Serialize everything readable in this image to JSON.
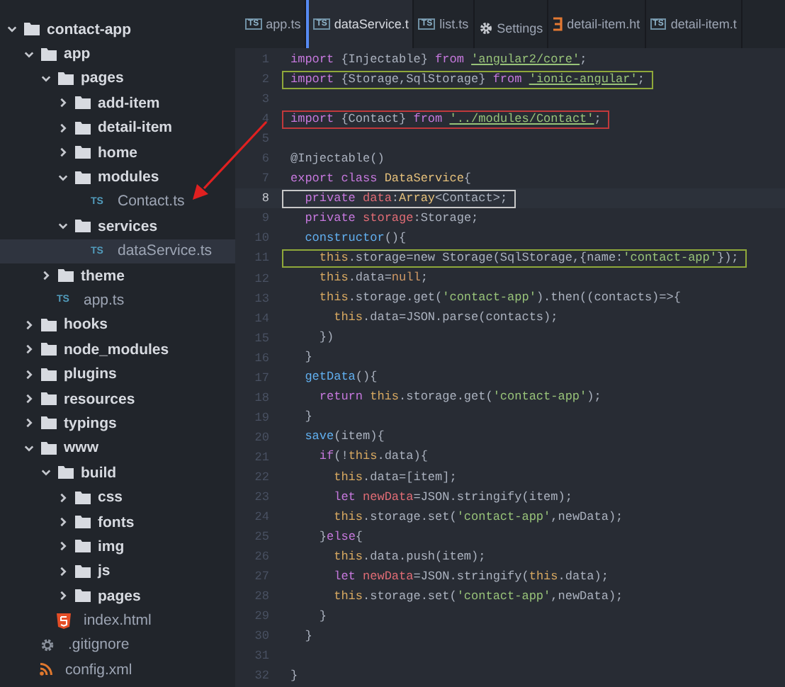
{
  "sidebar": {
    "tree": [
      {
        "name": "contact-app",
        "kind": "folder",
        "expanded": true,
        "selected": false,
        "children": [
          {
            "name": "app",
            "kind": "folder",
            "expanded": true,
            "selected": false,
            "children": [
              {
                "name": "pages",
                "kind": "folder",
                "expanded": true,
                "selected": false,
                "children": [
                  {
                    "name": "add-item",
                    "kind": "folder",
                    "expanded": false,
                    "selected": false
                  },
                  {
                    "name": "detail-item",
                    "kind": "folder",
                    "expanded": false,
                    "selected": false
                  },
                  {
                    "name": "home",
                    "kind": "folder",
                    "expanded": false,
                    "selected": false
                  },
                  {
                    "name": "modules",
                    "kind": "folder",
                    "expanded": true,
                    "selected": false,
                    "children": [
                      {
                        "name": "Contact.ts",
                        "kind": "ts",
                        "badge": "TS",
                        "selected": false
                      }
                    ]
                  },
                  {
                    "name": "services",
                    "kind": "folder",
                    "expanded": true,
                    "selected": false,
                    "children": [
                      {
                        "name": "dataService.ts",
                        "kind": "ts",
                        "badge": "TS",
                        "selected": true
                      }
                    ]
                  }
                ]
              },
              {
                "name": "theme",
                "kind": "folder",
                "expanded": false,
                "selected": false
              },
              {
                "name": "app.ts",
                "kind": "ts",
                "badge": "TS",
                "selected": false
              }
            ]
          },
          {
            "name": "hooks",
            "kind": "folder",
            "expanded": false,
            "selected": false
          },
          {
            "name": "node_modules",
            "kind": "folder",
            "expanded": false,
            "selected": false
          },
          {
            "name": "plugins",
            "kind": "folder",
            "expanded": false,
            "selected": false
          },
          {
            "name": "resources",
            "kind": "folder",
            "expanded": false,
            "selected": false
          },
          {
            "name": "typings",
            "kind": "folder",
            "expanded": false,
            "selected": false
          },
          {
            "name": "www",
            "kind": "folder",
            "expanded": true,
            "selected": false,
            "children": [
              {
                "name": "build",
                "kind": "folder",
                "expanded": true,
                "selected": false,
                "children": [
                  {
                    "name": "css",
                    "kind": "folder",
                    "expanded": false,
                    "selected": false
                  },
                  {
                    "name": "fonts",
                    "kind": "folder",
                    "expanded": false,
                    "selected": false
                  },
                  {
                    "name": "img",
                    "kind": "folder",
                    "expanded": false,
                    "selected": false
                  },
                  {
                    "name": "js",
                    "kind": "folder",
                    "expanded": false,
                    "selected": false
                  },
                  {
                    "name": "pages",
                    "kind": "folder",
                    "expanded": false,
                    "selected": false
                  }
                ]
              },
              {
                "name": "index.html",
                "kind": "html",
                "selected": false
              }
            ]
          },
          {
            "name": ".gitignore",
            "kind": "config",
            "selected": false
          },
          {
            "name": "config.xml",
            "kind": "xml",
            "selected": false
          }
        ]
      }
    ]
  },
  "tabs": [
    {
      "label": "app.ts",
      "kind": "ts",
      "badge": "TS",
      "selected": false
    },
    {
      "label": "dataService.t",
      "kind": "ts",
      "badge": "TS",
      "selected": true
    },
    {
      "label": "list.ts",
      "kind": "ts",
      "badge": "TS",
      "selected": false
    },
    {
      "label": "Settings",
      "kind": "settings",
      "selected": false
    },
    {
      "label": "detail-item.ht",
      "kind": "html",
      "selected": false
    },
    {
      "label": "detail-item.t",
      "kind": "ts",
      "badge": "TS",
      "selected": false
    }
  ],
  "editor": {
    "lines": [
      {
        "n": "1",
        "tokens": [
          {
            "kind": "kw",
            "text": "import"
          },
          {
            "kind": "plain",
            "text": " {Injectable} "
          },
          {
            "kind": "kw",
            "text": "from "
          },
          {
            "kind": "link",
            "text": "'angular2/core'"
          },
          {
            "kind": "plain",
            "text": ";"
          }
        ]
      },
      {
        "n": "2",
        "color": "#8fa83a",
        "tokens": [
          {
            "kind": "kw",
            "text": "import"
          },
          {
            "kind": "plain",
            "text": " {Storage,SqlStorage} "
          },
          {
            "kind": "kw",
            "text": "from "
          },
          {
            "kind": "link",
            "text": "'ionic-angular'"
          },
          {
            "kind": "plain",
            "text": ";"
          }
        ]
      },
      {
        "n": "3"
      },
      {
        "n": "4",
        "color": "#c0393b",
        "tokens": [
          {
            "kind": "kw",
            "text": "import"
          },
          {
            "kind": "plain",
            "text": " {Contact} "
          },
          {
            "kind": "kw",
            "text": "from "
          },
          {
            "kind": "link",
            "text": "'../modules/Contact'"
          },
          {
            "kind": "plain",
            "text": ";"
          }
        ]
      },
      {
        "n": "5"
      },
      {
        "n": "6",
        "tokens": [
          {
            "kind": "plain",
            "text": "@Injectable()"
          }
        ]
      },
      {
        "n": "7",
        "tokens": [
          {
            "kind": "kw",
            "text": "export class "
          },
          {
            "kind": "type",
            "text": "DataService"
          },
          {
            "kind": "plain",
            "text": "{"
          }
        ]
      },
      {
        "n": "8",
        "current": true,
        "color": "#c8c8c8",
        "tokens": [
          {
            "kind": "kw",
            "text": "  private "
          },
          {
            "kind": "var",
            "text": "data"
          },
          {
            "kind": "plain",
            "text": ":"
          },
          {
            "kind": "type",
            "text": "Array"
          },
          {
            "kind": "plain",
            "text": "<Contact>;"
          }
        ]
      },
      {
        "n": "9",
        "tokens": [
          {
            "kind": "kw",
            "text": "  private "
          },
          {
            "kind": "var",
            "text": "storage"
          },
          {
            "kind": "plain",
            "text": ":Storage;"
          }
        ]
      },
      {
        "n": "10",
        "tokens": [
          {
            "kind": "fn",
            "text": "  constructor"
          },
          {
            "kind": "plain",
            "text": "(){"
          }
        ]
      },
      {
        "n": "11",
        "color": "#8fa83a",
        "tokens": [
          {
            "kind": "this",
            "text": "    this"
          },
          {
            "kind": "plain",
            "text": ".storage=new Storage(SqlStorage,{name:"
          },
          {
            "kind": "str",
            "text": "'contact-app'"
          },
          {
            "kind": "plain",
            "text": "});"
          }
        ]
      },
      {
        "n": "12",
        "tokens": [
          {
            "kind": "this",
            "text": "    this"
          },
          {
            "kind": "plain",
            "text": ".data="
          },
          {
            "kind": "const",
            "text": "null"
          },
          {
            "kind": "plain",
            "text": ";"
          }
        ]
      },
      {
        "n": "13",
        "tokens": [
          {
            "kind": "this",
            "text": "    this"
          },
          {
            "kind": "plain",
            "text": ".storage.get("
          },
          {
            "kind": "str",
            "text": "'contact-app'"
          },
          {
            "kind": "plain",
            "text": ").then((contacts)=>{"
          }
        ]
      },
      {
        "n": "14",
        "tokens": [
          {
            "kind": "this",
            "text": "      this"
          },
          {
            "kind": "plain",
            "text": ".data=JSON.parse(contacts);"
          }
        ]
      },
      {
        "n": "15",
        "tokens": [
          {
            "kind": "plain",
            "text": "    })"
          }
        ]
      },
      {
        "n": "16",
        "tokens": [
          {
            "kind": "plain",
            "text": "  }"
          }
        ]
      },
      {
        "n": "17",
        "tokens": [
          {
            "kind": "fn",
            "text": "  getData"
          },
          {
            "kind": "plain",
            "text": "(){"
          }
        ]
      },
      {
        "n": "18",
        "tokens": [
          {
            "kind": "kw",
            "text": "    return "
          },
          {
            "kind": "this",
            "text": "this"
          },
          {
            "kind": "plain",
            "text": ".storage.get("
          },
          {
            "kind": "str",
            "text": "'contact-app'"
          },
          {
            "kind": "plain",
            "text": ");"
          }
        ]
      },
      {
        "n": "19",
        "tokens": [
          {
            "kind": "plain",
            "text": "  }"
          }
        ]
      },
      {
        "n": "20",
        "tokens": [
          {
            "kind": "fn",
            "text": "  save"
          },
          {
            "kind": "plain",
            "text": "(item){"
          }
        ]
      },
      {
        "n": "21",
        "tokens": [
          {
            "kind": "kw",
            "text": "    if"
          },
          {
            "kind": "plain",
            "text": "(!"
          },
          {
            "kind": "this",
            "text": "this"
          },
          {
            "kind": "plain",
            "text": ".data){"
          }
        ]
      },
      {
        "n": "22",
        "tokens": [
          {
            "kind": "this",
            "text": "      this"
          },
          {
            "kind": "plain",
            "text": ".data=[item];"
          }
        ]
      },
      {
        "n": "23",
        "tokens": [
          {
            "kind": "kw",
            "text": "      let "
          },
          {
            "kind": "var",
            "text": "newData"
          },
          {
            "kind": "plain",
            "text": "=JSON.stringify(item);"
          }
        ]
      },
      {
        "n": "24",
        "tokens": [
          {
            "kind": "this",
            "text": "      this"
          },
          {
            "kind": "plain",
            "text": ".storage.set("
          },
          {
            "kind": "str",
            "text": "'contact-app'"
          },
          {
            "kind": "plain",
            "text": ",newData);"
          }
        ]
      },
      {
        "n": "25",
        "tokens": [
          {
            "kind": "plain",
            "text": "    }"
          },
          {
            "kind": "kw",
            "text": "else"
          },
          {
            "kind": "plain",
            "text": "{"
          }
        ]
      },
      {
        "n": "26",
        "tokens": [
          {
            "kind": "this",
            "text": "      this"
          },
          {
            "kind": "plain",
            "text": ".data.push(item);"
          }
        ]
      },
      {
        "n": "27",
        "tokens": [
          {
            "kind": "kw",
            "text": "      let "
          },
          {
            "kind": "var",
            "text": "newData"
          },
          {
            "kind": "plain",
            "text": "=JSON.stringify("
          },
          {
            "kind": "this",
            "text": "this"
          },
          {
            "kind": "plain",
            "text": ".data);"
          }
        ]
      },
      {
        "n": "28",
        "tokens": [
          {
            "kind": "this",
            "text": "      this"
          },
          {
            "kind": "plain",
            "text": ".storage.set("
          },
          {
            "kind": "str",
            "text": "'contact-app'"
          },
          {
            "kind": "plain",
            "text": ",newData);"
          }
        ]
      },
      {
        "n": "29",
        "tokens": [
          {
            "kind": "plain",
            "text": "    }"
          }
        ]
      },
      {
        "n": "30",
        "tokens": [
          {
            "kind": "plain",
            "text": "  }"
          }
        ]
      },
      {
        "n": "31"
      },
      {
        "n": "32",
        "tokens": [
          {
            "kind": "plain",
            "text": "}"
          }
        ]
      }
    ]
  }
}
